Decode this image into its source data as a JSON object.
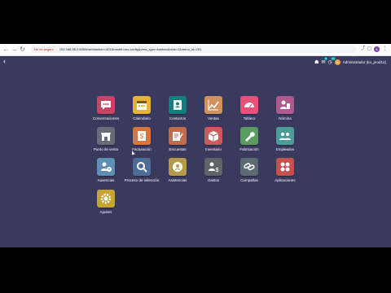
{
  "browser": {
    "warning": "No es seguro",
    "url": "192.168.56.2:8069/web#action=401&model=res.config&view_type=kanban&cids=1&menu_id=251",
    "profile_initial": "A"
  },
  "topbar": {
    "chat_badge": "5",
    "activity_badge": "41",
    "avatar_initial": "A",
    "user": "Administrador (ko_prod14)"
  },
  "apps": [
    {
      "label": "Conversaciones",
      "color": "#c94464",
      "icon": "chat-icon"
    },
    {
      "label": "Calendario",
      "color": "#e7b533",
      "icon": "calendar-icon"
    },
    {
      "label": "Contactos",
      "color": "#14807e",
      "icon": "contact-card-icon"
    },
    {
      "label": "Ventas",
      "color": "#d2925f",
      "icon": "chart-up-icon"
    },
    {
      "label": "Tablero",
      "color": "#e9507a",
      "icon": "gauge-icon"
    },
    {
      "label": "Nómina",
      "color": "#b0598e",
      "icon": "payroll-icon"
    },
    {
      "label": "Punto de venta",
      "color": "#6a6d78",
      "icon": "store-icon"
    },
    {
      "label": "Facturación",
      "color": "#d9743c",
      "icon": "invoice-icon"
    },
    {
      "label": "Encuestas",
      "color": "#c06d4d",
      "icon": "survey-icon"
    },
    {
      "label": "Inventario",
      "color": "#cc5a5a",
      "icon": "box-icon"
    },
    {
      "label": "Fabricación",
      "color": "#5b9b60",
      "icon": "wrench-icon"
    },
    {
      "label": "Empleados",
      "color": "#4e9c99",
      "icon": "people-icon"
    },
    {
      "label": "Ausencias",
      "color": "#5e8fb4",
      "icon": "user-clock-icon"
    },
    {
      "label": "Proceso de selección",
      "color": "#4d6d96",
      "icon": "search-icon"
    },
    {
      "label": "Asistencias",
      "color": "#b59a4b",
      "icon": "attendance-icon"
    },
    {
      "label": "Gastos",
      "color": "#5f6468",
      "icon": "expense-icon"
    },
    {
      "label": "Campañas",
      "color": "#5c6a73",
      "icon": "link-icon"
    },
    {
      "label": "Aplicaciones",
      "color": "#c5504d",
      "icon": "apps-icon"
    },
    {
      "label": "Ajustes",
      "color": "#c5a532",
      "icon": "gear-icon"
    }
  ]
}
